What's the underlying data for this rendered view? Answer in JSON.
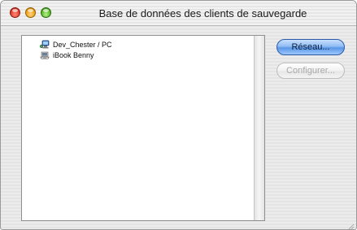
{
  "window": {
    "title": "Base de données des clients de sauvegarde"
  },
  "client_list": {
    "items": [
      {
        "label": "Dev_Chester / PC",
        "icon": "network-computer-icon"
      },
      {
        "label": "iBook Benny",
        "icon": "laptop-computer-icon"
      }
    ]
  },
  "buttons": {
    "network_label": "Réseau...",
    "configure_label": "Configurer...",
    "configure_enabled": false
  },
  "colors": {
    "default_button": "#5a96e6",
    "disabled_text": "#a8a8a8"
  }
}
